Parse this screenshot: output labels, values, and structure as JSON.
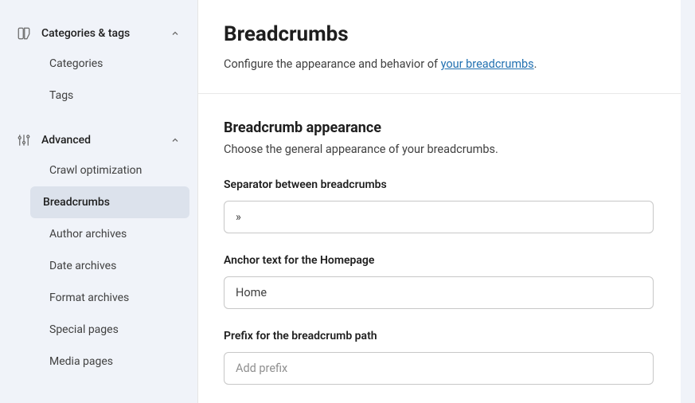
{
  "sidebar": {
    "sections": [
      {
        "label": "Categories & tags",
        "items": [
          {
            "label": "Categories"
          },
          {
            "label": "Tags"
          }
        ]
      },
      {
        "label": "Advanced",
        "items": [
          {
            "label": "Crawl optimization"
          },
          {
            "label": "Breadcrumbs"
          },
          {
            "label": "Author archives"
          },
          {
            "label": "Date archives"
          },
          {
            "label": "Format archives"
          },
          {
            "label": "Special pages"
          },
          {
            "label": "Media pages"
          }
        ]
      }
    ]
  },
  "header": {
    "title": "Breadcrumbs",
    "desc_prefix": "Configure the appearance and behavior of ",
    "desc_link": "your breadcrumbs",
    "desc_suffix": "."
  },
  "appearance": {
    "title": "Breadcrumb appearance",
    "desc": "Choose the general appearance of your breadcrumbs.",
    "fields": {
      "separator": {
        "label": "Separator between breadcrumbs",
        "value": "»"
      },
      "anchor": {
        "label": "Anchor text for the Homepage",
        "value": "Home"
      },
      "prefix": {
        "label": "Prefix for the breadcrumb path",
        "value": "",
        "placeholder": "Add prefix"
      }
    }
  }
}
